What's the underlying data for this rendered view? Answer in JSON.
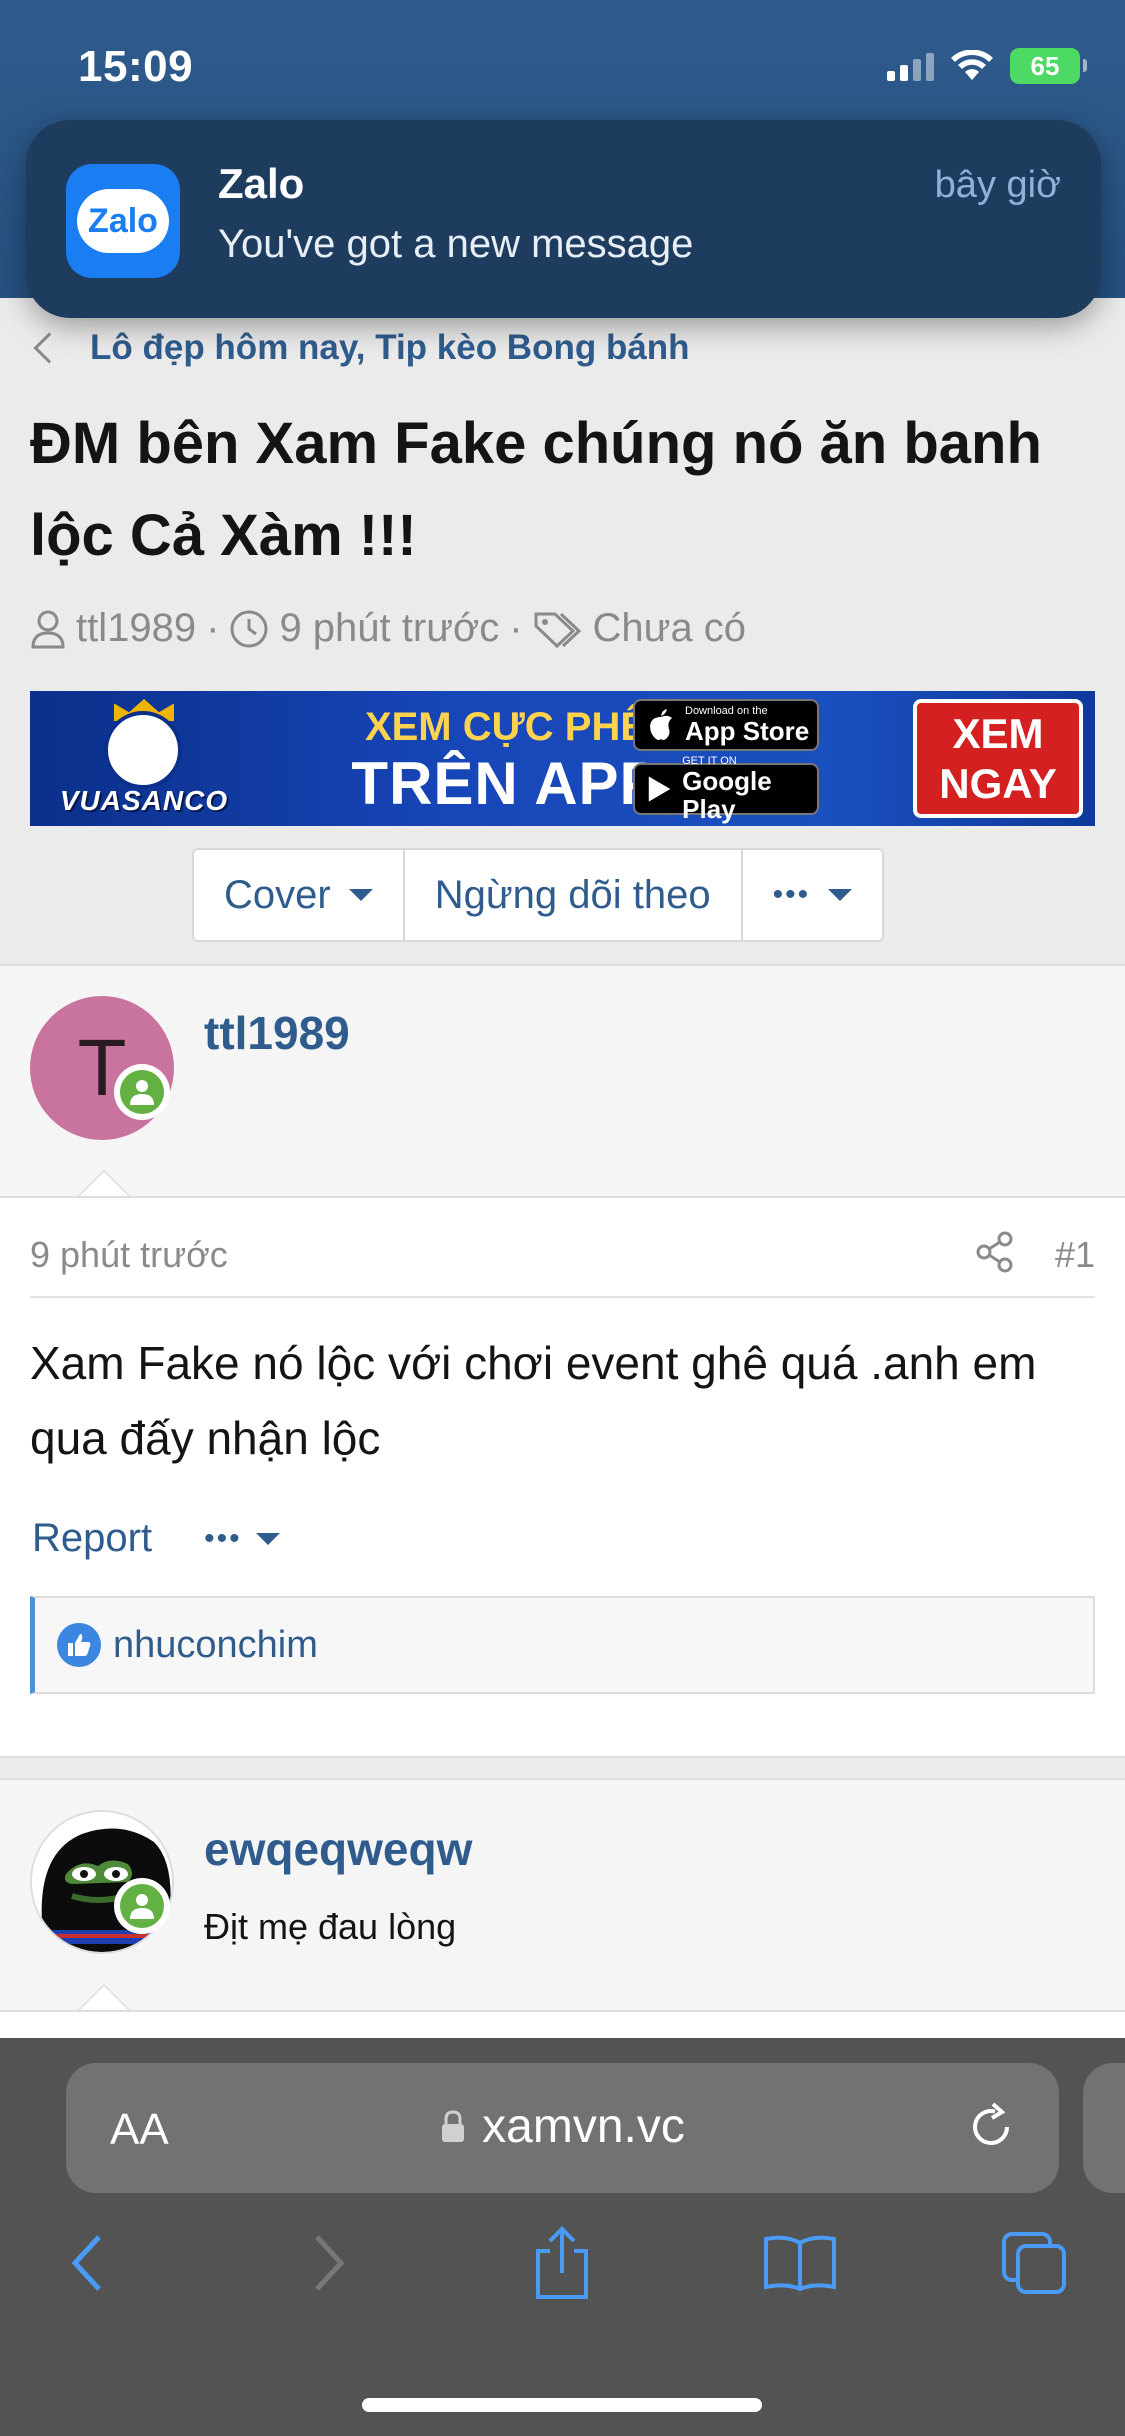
{
  "status_bar": {
    "time": "15:09",
    "battery": "65"
  },
  "notification": {
    "app_icon_text": "Zalo",
    "app_name": "Zalo",
    "time": "bây giờ",
    "message": "You've got a new message"
  },
  "breadcrumb": {
    "label": "Lô đẹp hôm nay, Tip kèo Bong bánh"
  },
  "thread": {
    "title": "ĐM bên Xam Fake chúng nó ăn banh lộc Cả Xàm !!!",
    "author": "ttl1989",
    "time": "9 phút trước",
    "tags": "Chưa có"
  },
  "banner": {
    "logo_text": "VUASANCO",
    "headline1": "XEM CỰC PHÊ",
    "headline2": "TRÊN APP",
    "app_store_small": "Download on the",
    "app_store": "App Store",
    "google_play_small": "GET IT ON",
    "google_play": "Google Play",
    "cta_line1": "XEM",
    "cta_line2": "NGAY"
  },
  "actions": {
    "cover": "Cover",
    "unfollow": "Ngừng dõi theo",
    "more": "•••"
  },
  "post1": {
    "avatar_letter": "T",
    "author": "ttl1989",
    "time": "9 phút trước",
    "number": "#1",
    "text": "Xam Fake nó lộc với chơi event ghê quá .anh em qua đấy nhận lộc",
    "report": "Report",
    "more": "•••",
    "liked_by": "nhuconchim"
  },
  "post2": {
    "author": "ewqeqweqw",
    "text": "Địt mẹ đau lòng"
  },
  "browser": {
    "aa_label": "AA",
    "url": "xamvn.vc"
  },
  "colors": {
    "link": "#2f5c8d",
    "header": "#2f5c8d",
    "online": "#63b043"
  }
}
